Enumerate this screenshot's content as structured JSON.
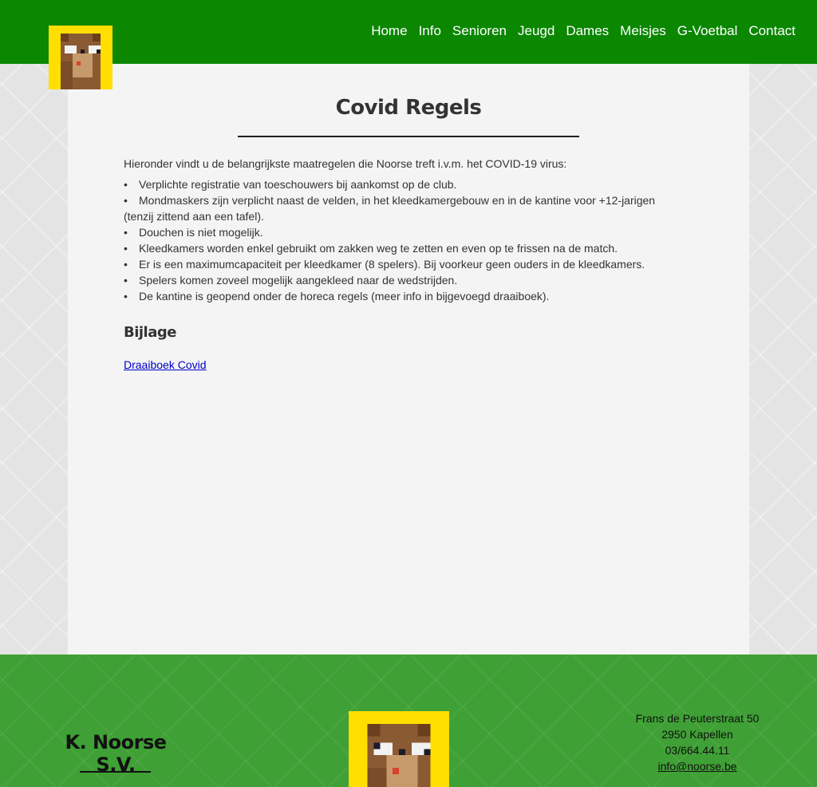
{
  "header": {
    "nav": [
      "Home",
      "Info",
      "Senioren",
      "Jeugd",
      "Dames",
      "Meisjes",
      "G-Voetbal",
      "Contact"
    ]
  },
  "page": {
    "title": "Covid Regels",
    "intro": "Hieronder vindt u de belangrijkste maatregelen die Noorse treft i.v.m. het COVID-19 virus:",
    "rules": [
      "Verplichte registratie van toeschouwers bij aankomst op de club.",
      "Mondmaskers zijn verplicht naast de velden, in het kleedkamergebouw en in de kantine voor +12-jarigen (tenzij zittend aan een tafel).",
      "Douchen is niet mogelijk.",
      "Kleedkamers worden enkel gebruikt om zakken weg te zetten en even op te frissen na de match.",
      "Er is een maximumcapaciteit per kleedkamer (8 spelers). Bij voorkeur geen ouders in de kleedkamers.",
      "Spelers komen zoveel mogelijk aangekleed naar de wedstrijden.",
      "De kantine is geopend onder de horeca regels (meer info in bijgevoegd draaiboek)."
    ],
    "section_title": "Bijlage",
    "attachment_link": "Draaiboek Covid"
  },
  "footer": {
    "club_name": "K. Noorse S.V.",
    "address_street": "Frans de Peuterstraat 50",
    "address_city": "2950 Kapellen",
    "phone": "03/664.44.11",
    "email": "info@noorse.be"
  },
  "colors": {
    "header_green": "#0b8702",
    "footer_green": "#3fa035",
    "logo_yellow": "#ffde00",
    "link_blue": "#0000cc"
  }
}
